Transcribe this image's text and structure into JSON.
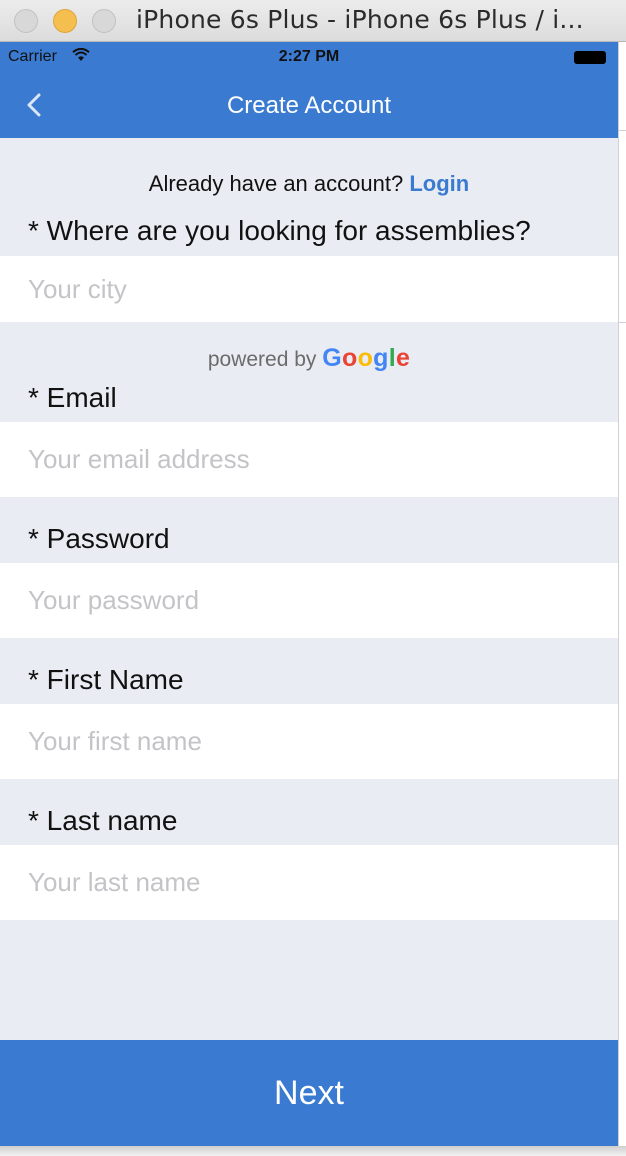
{
  "window": {
    "title": "iPhone 6s Plus - iPhone 6s Plus / i..."
  },
  "statusbar": {
    "carrier": "Carrier",
    "time": "2:27 PM"
  },
  "navbar": {
    "title": "Create Account"
  },
  "login_prompt": {
    "text": "Already have an account?",
    "link": "Login"
  },
  "form": {
    "city": {
      "label": "* Where are you looking for assemblies?",
      "placeholder": "Your city",
      "value": ""
    },
    "powered_by": "powered by",
    "email": {
      "label": "* Email",
      "placeholder": "Your email address",
      "value": ""
    },
    "password": {
      "label": "* Password",
      "placeholder": "Your password",
      "value": ""
    },
    "first_name": {
      "label": "* First Name",
      "placeholder": "Your first name",
      "value": ""
    },
    "last_name": {
      "label": "* Last name",
      "placeholder": "Your last name",
      "value": ""
    }
  },
  "actions": {
    "next_label": "Next"
  },
  "colors": {
    "accent": "#3a7bd1",
    "background": "#e9ecf2",
    "placeholder": "#c4c4c8"
  },
  "icons": [
    "close-window-icon",
    "minimize-window-icon",
    "zoom-window-icon",
    "wifi-icon",
    "battery-icon",
    "back-chevron-icon",
    "google-logo"
  ]
}
